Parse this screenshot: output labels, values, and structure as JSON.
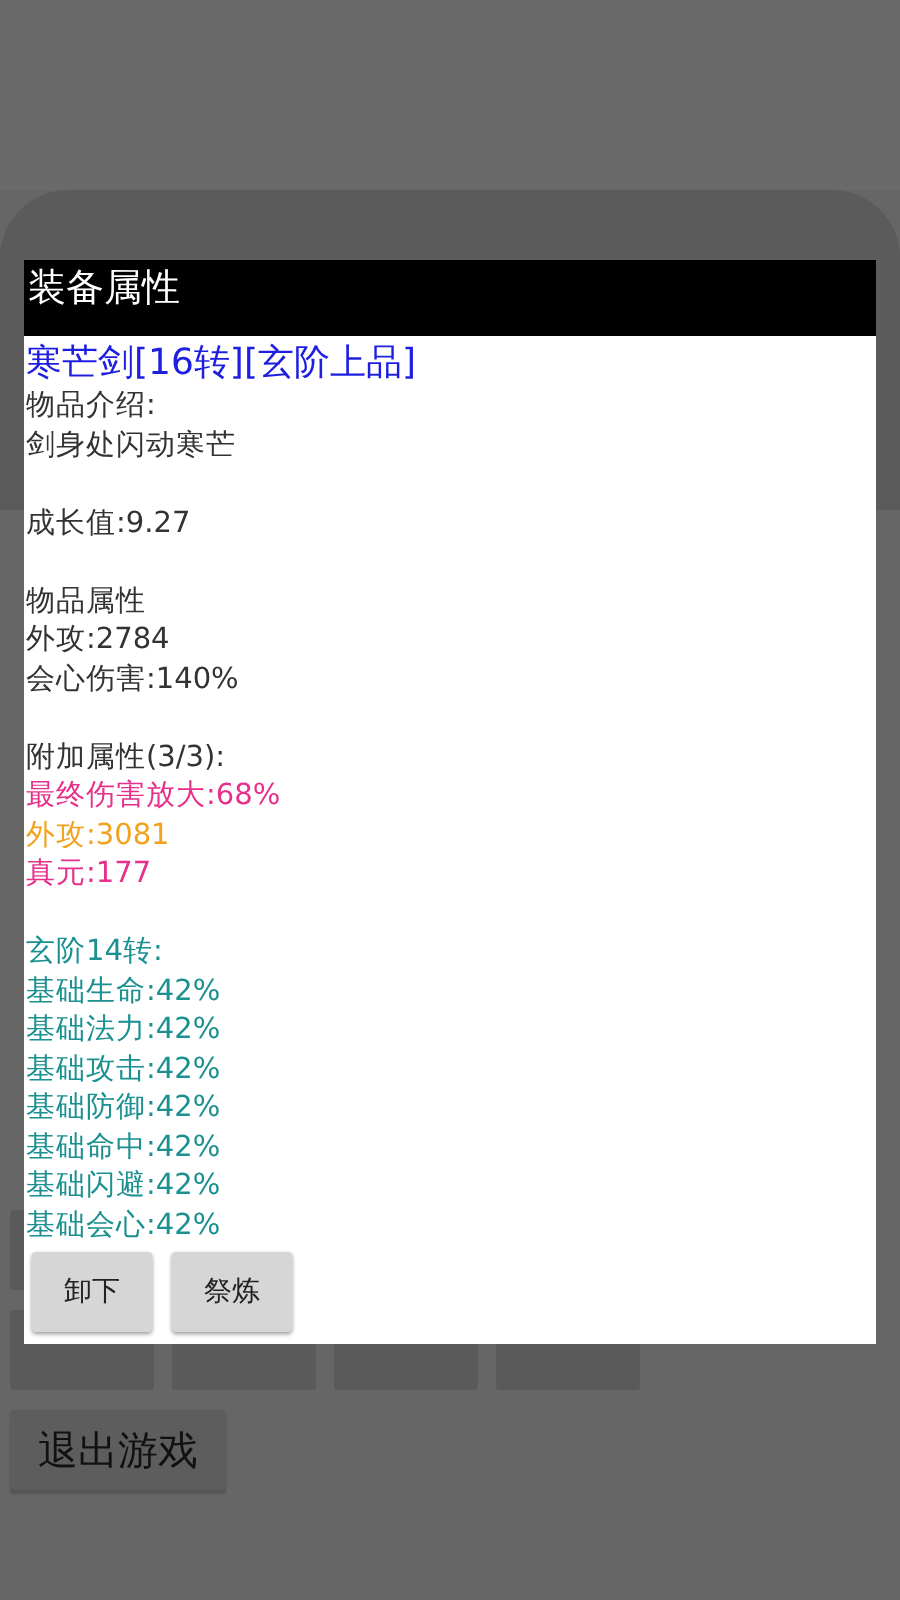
{
  "background": {
    "exit_button": "退出游戏"
  },
  "dialog": {
    "title": "装备属性",
    "item_name": "寒芒剑[16转][玄阶上品]",
    "sections": [
      {
        "lines": [
          {
            "text": "物品介绍:",
            "color": "#333333"
          },
          {
            "text": "剑身处闪动寒芒",
            "color": "#333333"
          }
        ]
      },
      {
        "lines": [
          {
            "text": "成长值:9.27",
            "color": "#333333"
          }
        ]
      },
      {
        "lines": [
          {
            "text": "物品属性",
            "color": "#333333"
          },
          {
            "text": "外攻:2784",
            "color": "#333333"
          },
          {
            "text": "会心伤害:140%",
            "color": "#333333"
          }
        ]
      },
      {
        "lines": [
          {
            "text": "附加属性(3/3):",
            "color": "#333333"
          },
          {
            "text": "最终伤害放大:68%",
            "color": "#e6308c"
          },
          {
            "text": "外攻:3081",
            "color": "#f2a21c"
          },
          {
            "text": "真元:177",
            "color": "#e6308c"
          }
        ]
      },
      {
        "lines": [
          {
            "text": "玄阶14转:",
            "color": "#1b9090"
          },
          {
            "text": "基础生命:42%",
            "color": "#1b9090"
          },
          {
            "text": "基础法力:42%",
            "color": "#1b9090"
          },
          {
            "text": "基础攻击:42%",
            "color": "#1b9090"
          },
          {
            "text": "基础防御:42%",
            "color": "#1b9090"
          },
          {
            "text": "基础命中:42%",
            "color": "#1b9090"
          },
          {
            "text": "基础闪避:42%",
            "color": "#1b9090"
          },
          {
            "text": "基础会心:42%",
            "color": "#1b9090"
          }
        ]
      }
    ],
    "buttons": [
      "卸下",
      "祭炼"
    ]
  }
}
